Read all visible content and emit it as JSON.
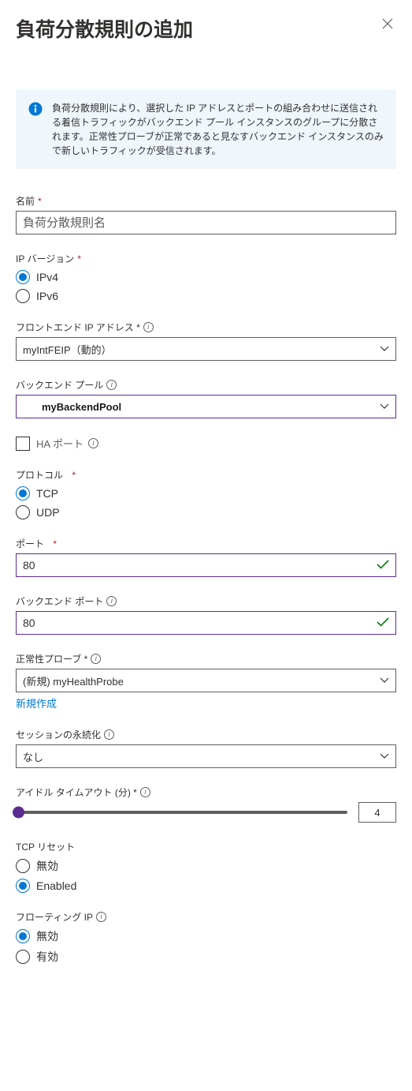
{
  "header": {
    "title": "負荷分散規則の追加"
  },
  "infobox": {
    "message": "負荷分散規則により、選択した IP アドレスとポートの組み合わせに送信される着信トラフィックがバックエンド プール インスタンスのグループに分散されます。正常性プローブが正常であると見なすバックエンド インスタンスのみで新しいトラフィックが受信されます。"
  },
  "fields": {
    "name": {
      "label": "名前",
      "placeholder": "負荷分散規則名"
    },
    "ip_version": {
      "label": "IP バージョン",
      "options": {
        "v4": "IPv4",
        "v6": "IPv6"
      }
    },
    "frontend_ip": {
      "label": "フロントエンド IP アドレス *",
      "value": "myIntFEIP（動的）"
    },
    "backend_pool": {
      "label": "バックエンド プール",
      "value": "myBackendPool"
    },
    "ha_port": {
      "label": "HA ポート"
    },
    "protocol": {
      "label": "プロトコル",
      "options": {
        "tcp": "TCP",
        "udp": "UDP"
      }
    },
    "port": {
      "label": "ポート",
      "value": "80"
    },
    "backend_port": {
      "label": "バックエンド ポート",
      "value": "80"
    },
    "health_probe": {
      "label": "正常性プローブ *",
      "value": "(新規) myHealthProbe",
      "create_link": "新規作成"
    },
    "session_persistence": {
      "label": "セッションの永続化",
      "value": "なし"
    },
    "idle_timeout": {
      "label": "アイドル タイムアウト (分) *",
      "value": "4"
    },
    "tcp_reset": {
      "label": "TCP リセット",
      "options": {
        "disabled": "無効",
        "enabled": "Enabled"
      }
    },
    "floating_ip": {
      "label": "フローティング IP",
      "options": {
        "disabled": "無効",
        "enabled": "有効"
      }
    }
  }
}
